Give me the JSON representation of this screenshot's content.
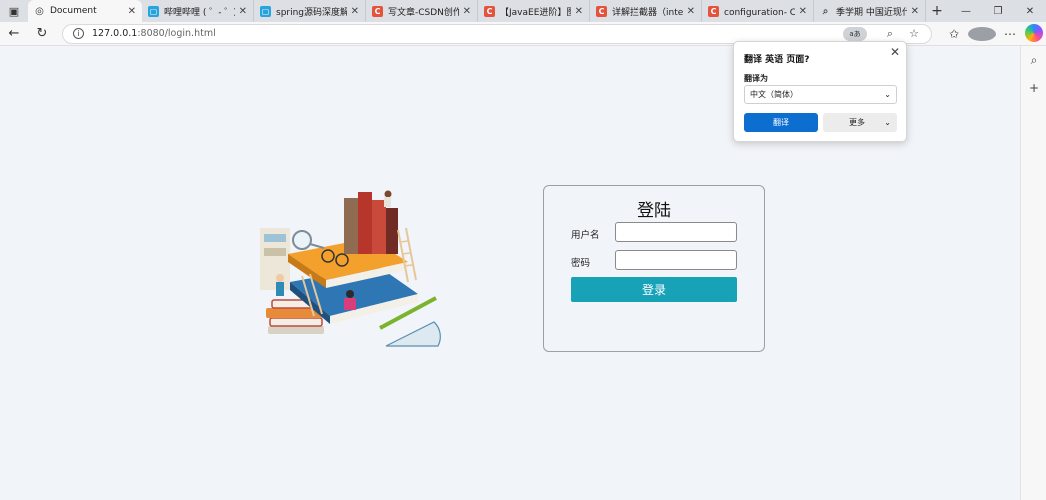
{
  "tabs": [
    {
      "title": "Document",
      "icon": "globe-icon",
      "active": true
    },
    {
      "title": "哔哩哔哩 ( ゜- ゜)つロ",
      "icon": "bilibili-icon"
    },
    {
      "title": "spring源码深度解析-嘿",
      "icon": "bilibili-icon"
    },
    {
      "title": "写文章-CSDN创作中心",
      "icon": "csdn-icon"
    },
    {
      "title": "【JavaEE进阶】图书管",
      "icon": "csdn-icon"
    },
    {
      "title": "详解拦截器（intercepto",
      "icon": "csdn-icon"
    },
    {
      "title": "configuration- CSDN搜",
      "icon": "csdn-icon"
    },
    {
      "title": "季学期 中国近现代史纲",
      "icon": "search-icon"
    }
  ],
  "address": {
    "host": "127.0.0.1",
    "path": ":8080/login.html",
    "translate_badge": "aあ"
  },
  "login": {
    "title": "登陆",
    "username_label": "用户名",
    "password_label": "密码",
    "username_value": "",
    "password_value": "",
    "submit_label": "登录"
  },
  "translate_popup": {
    "title": "翻译 英语 页面?",
    "target_label": "翻译为",
    "target_value": "中文（简体）",
    "translate_button": "翻译",
    "more_button": "更多"
  },
  "colors": {
    "login_button": "#17a2b8",
    "translate_button": "#0c6fd0",
    "csdn_red": "#e5533d",
    "bilibili_blue": "#27a4dd"
  }
}
